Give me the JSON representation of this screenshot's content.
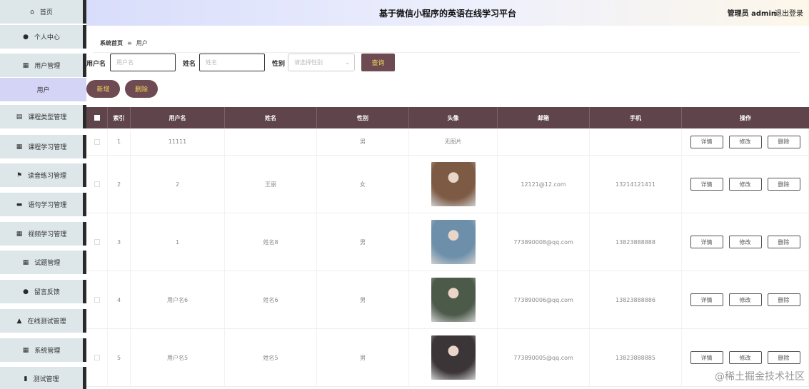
{
  "sidebar": {
    "items": [
      {
        "label": "首页",
        "icon": "home-icon",
        "glyph": "⌂"
      },
      {
        "label": "个人中心",
        "icon": "person-icon",
        "glyph": "●"
      },
      {
        "label": "用户管理",
        "icon": "grid-icon",
        "glyph": "▦"
      },
      {
        "label": "用户",
        "icon": "",
        "glyph": ""
      },
      {
        "label": "课程类型管理",
        "icon": "document-icon",
        "glyph": "▤"
      },
      {
        "label": "课程学习管理",
        "icon": "grid-icon",
        "glyph": "▦"
      },
      {
        "label": "读音练习管理",
        "icon": "flag-icon",
        "glyph": "⚑"
      },
      {
        "label": "语句学习管理",
        "icon": "briefcase-icon",
        "glyph": "▬"
      },
      {
        "label": "视频学习管理",
        "icon": "grid-icon",
        "glyph": "▦"
      },
      {
        "label": "试题管理",
        "icon": "grid-icon",
        "glyph": "▦"
      },
      {
        "label": "留言反馈",
        "icon": "bulb-icon",
        "glyph": "●"
      },
      {
        "label": "在线测试管理",
        "icon": "user-upload-icon",
        "glyph": "▲"
      },
      {
        "label": "系统管理",
        "icon": "grid-icon",
        "glyph": "▦"
      },
      {
        "label": "测试管理",
        "icon": "bar-chart-icon",
        "glyph": "▮"
      }
    ]
  },
  "header": {
    "title": "基于微信小程序的英语在线学习平台",
    "user": "管理员 admin",
    "logout": "退出登录"
  },
  "breadcrumb": {
    "home": "系统首页",
    "sep": "≡",
    "current": "用户"
  },
  "search": {
    "username_label": "用户名",
    "username_placeholder": "用户名",
    "name_label": "姓名",
    "name_placeholder": "姓名",
    "gender_label": "性别",
    "gender_placeholder": "请选择性别",
    "query_button": "查询"
  },
  "actions": {
    "add": "新增",
    "delete": "删除"
  },
  "table": {
    "headers": [
      "索引",
      "用户名",
      "姓名",
      "性别",
      "头像",
      "邮箱",
      "手机",
      "操作"
    ],
    "rows": [
      {
        "index": "1",
        "username": "11111",
        "name": "",
        "gender": "男",
        "avatar_text": "无图片",
        "avatar": "",
        "email": "",
        "phone": ""
      },
      {
        "index": "2",
        "username": "2",
        "name": "王丽",
        "gender": "女",
        "avatar_text": "",
        "avatar": "#7d5a43",
        "email": "12121@12.com",
        "phone": "13214121411"
      },
      {
        "index": "3",
        "username": "1",
        "name": "姓名8",
        "gender": "男",
        "avatar_text": "",
        "avatar": "#6d8faa",
        "email": "773890008@qq.com",
        "phone": "13823888888"
      },
      {
        "index": "4",
        "username": "用户名6",
        "name": "姓名6",
        "gender": "男",
        "avatar_text": "",
        "avatar": "#4c5a4a",
        "email": "773890006@qq.com",
        "phone": "13823888886"
      },
      {
        "index": "5",
        "username": "用户名5",
        "name": "姓名5",
        "gender": "男",
        "avatar_text": "",
        "avatar": "#3c3538",
        "email": "773890005@qq.com",
        "phone": "13823888885"
      }
    ],
    "row_actions": {
      "detail": "详情",
      "edit": "修改",
      "delete": "删除"
    }
  },
  "watermark": "@稀土掘金技术社区"
}
